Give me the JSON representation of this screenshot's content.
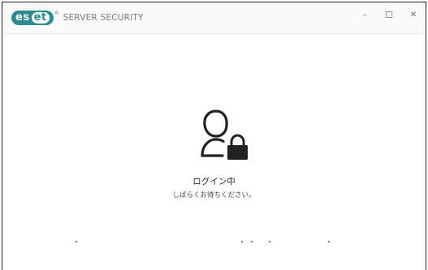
{
  "window": {
    "brand_es": "es",
    "brand_et": "et",
    "brand_reg": "®",
    "product_name": "SERVER SECURITY",
    "minimize_glyph": "–",
    "maximize_glyph": "☐",
    "close_glyph": "✕"
  },
  "login": {
    "icon": "user-lock-icon",
    "title": "ログイン中",
    "subtitle": "しばらくお待ちください。"
  },
  "colors": {
    "brand": "#2b8c8f",
    "background": "#ffffff",
    "text": "#2a2a2a"
  }
}
